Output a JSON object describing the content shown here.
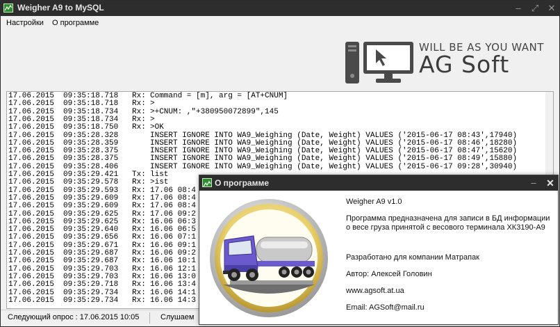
{
  "window": {
    "title": "Weigher A9 to MySQL",
    "title_icon": "app-icon",
    "controls": {
      "minimize": "–",
      "maximize": "⤢",
      "close": "✕"
    }
  },
  "menu": {
    "settings": "Настройки",
    "about": "О программе"
  },
  "logo": {
    "tagline": "WILL BE AS YOU WANT",
    "name": "AG Soft"
  },
  "log": [
    {
      "date": "17.06.2015",
      "time": "09:35:18.718",
      "dir": "Rx:",
      "msg": "Command = [m], arg = [AT+CNUM]"
    },
    {
      "date": "17.06.2015",
      "time": "09:35:18.718",
      "dir": "Rx:",
      "msg": ">"
    },
    {
      "date": "17.06.2015",
      "time": "09:35:18.734",
      "dir": "Rx:",
      "msg": ">+CNUM: ,\"+380950072899\",145"
    },
    {
      "date": "17.06.2015",
      "time": "09:35:18.734",
      "dir": "Rx:",
      "msg": ">"
    },
    {
      "date": "17.06.2015",
      "time": "09:35:18.750",
      "dir": "Rx:",
      "msg": ">OK"
    },
    {
      "date": "17.06.2015",
      "time": "09:35:28.328",
      "dir": "",
      "msg": "INSERT IGNORE INTO WA9_Weighing (Date, Weight) VALUES ('2015-06-17 08:43',17940)"
    },
    {
      "date": "17.06.2015",
      "time": "09:35:28.359",
      "dir": "",
      "msg": "INSERT IGNORE INTO WA9_Weighing (Date, Weight) VALUES ('2015-06-17 08:46',18280)"
    },
    {
      "date": "17.06.2015",
      "time": "09:35:28.375",
      "dir": "",
      "msg": "INSERT IGNORE INTO WA9_Weighing (Date, Weight) VALUES ('2015-06-17 08:47',15620)"
    },
    {
      "date": "17.06.2015",
      "time": "09:35:28.375",
      "dir": "",
      "msg": "INSERT IGNORE INTO WA9_Weighing (Date, Weight) VALUES ('2015-06-17 08:49',15880)"
    },
    {
      "date": "17.06.2015",
      "time": "09:35:28.406",
      "dir": "",
      "msg": "INSERT IGNORE INTO WA9_Weighing (Date, Weight) VALUES ('2015-06-17 09:28',30940)"
    },
    {
      "date": "17.06.2015",
      "time": "09:35:29.421",
      "dir": "Tx:",
      "msg": "list"
    },
    {
      "date": "17.06.2015",
      "time": "09:35:29.578",
      "dir": "Rx:",
      "msg": ">ist"
    },
    {
      "date": "17.06.2015",
      "time": "09:35:29.593",
      "dir": "Rx:",
      "msg": "17.06 08:4"
    },
    {
      "date": "17.06.2015",
      "time": "09:35:29.609",
      "dir": "Rx:",
      "msg": "17.06 08:4"
    },
    {
      "date": "17.06.2015",
      "time": "09:35:29.609",
      "dir": "Rx:",
      "msg": "17.06 08:4"
    },
    {
      "date": "17.06.2015",
      "time": "09:35:29.625",
      "dir": "Rx:",
      "msg": "17.06 09:2"
    },
    {
      "date": "17.06.2015",
      "time": "09:35:29.625",
      "dir": "Rx:",
      "msg": "16.06 06:3"
    },
    {
      "date": "17.06.2015",
      "time": "09:35:29.640",
      "dir": "Rx:",
      "msg": "16.06 06:5"
    },
    {
      "date": "17.06.2015",
      "time": "09:35:29.656",
      "dir": "Rx:",
      "msg": "16.06 07:1"
    },
    {
      "date": "17.06.2015",
      "time": "09:35:29.671",
      "dir": "Rx:",
      "msg": "16.06 09:1"
    },
    {
      "date": "17.06.2015",
      "time": "09:35:29.687",
      "dir": "Rx:",
      "msg": "16.06 09:2"
    },
    {
      "date": "17.06.2015",
      "time": "09:35:29.687",
      "dir": "Rx:",
      "msg": "16.06 10:1"
    },
    {
      "date": "17.06.2015",
      "time": "09:35:29.703",
      "dir": "Rx:",
      "msg": "16.06 12:1"
    },
    {
      "date": "17.06.2015",
      "time": "09:35:29.703",
      "dir": "Rx:",
      "msg": "16.06 13:0"
    },
    {
      "date": "17.06.2015",
      "time": "09:35:29.718",
      "dir": "Rx:",
      "msg": "16.06 13:4"
    },
    {
      "date": "17.06.2015",
      "time": "09:35:29.734",
      "dir": "Rx:",
      "msg": "16.06 14:1"
    },
    {
      "date": "17.06.2015",
      "time": "09:35:29.734",
      "dir": "Rx:",
      "msg": "16.06 14:3"
    }
  ],
  "status": {
    "next_poll": "Следующий опрос : 17.06.2015 10:05",
    "listening": "Слушаем"
  },
  "about": {
    "title": "О программе",
    "version": "Weigher A9 v1.0",
    "description": "Программа предназначена для записи в БД информации о весе груза принятой с весового терминала ХК3190-А9",
    "developed_for": "Разработано для компании Матрапак",
    "author": "Автор: Алексей Головин",
    "website": "www.agsoft.at.ua",
    "email": "Email: AGSoft@mail.ru",
    "controls": {
      "minimize": "–",
      "close": "✕"
    }
  },
  "colors": {
    "titlebar": "#2d2d2d",
    "window_bg": "#f0f0f0",
    "icon_green": "#2e8b2e",
    "truck_purple": "#6a5acd",
    "disc_gold": "#d4b84a"
  }
}
